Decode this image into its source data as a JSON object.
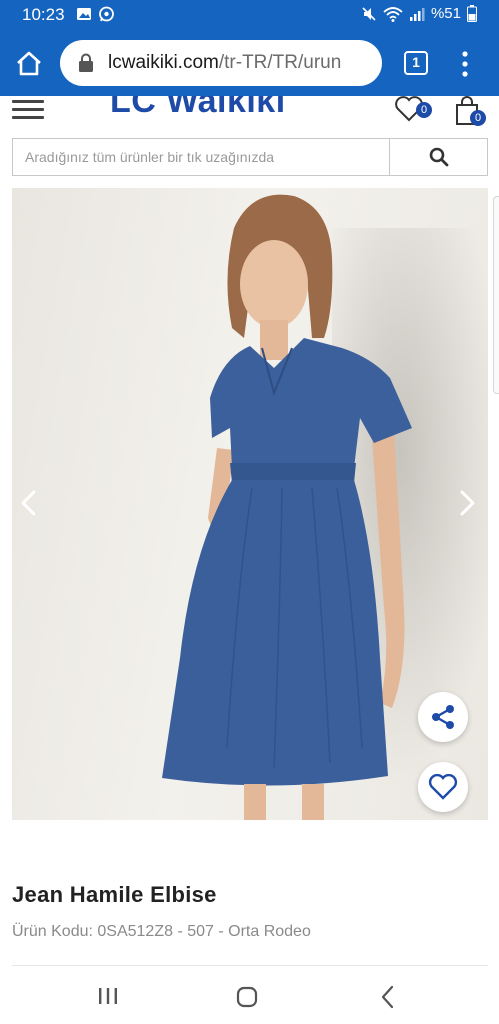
{
  "status_bar": {
    "time": "10:23",
    "battery": "%51"
  },
  "browser": {
    "url_host": "lcwaikiki.com",
    "url_path": "/tr-TR/TR/urun",
    "tab_count": "1"
  },
  "header": {
    "logo": "LC Waikiki",
    "wishlist_count": "0",
    "cart_count": "0"
  },
  "search": {
    "placeholder": "Aradığınız tüm ürünler bir tık uzağınızda"
  },
  "product": {
    "title": "Jean Hamile Elbise",
    "code": "Ürün Kodu: 0SA512Z8 - 507 - Orta Rodeo"
  },
  "colors": {
    "brand_blue": "#1565c0",
    "logo_blue": "#1e4aa8",
    "denim": "#3a5f9a"
  }
}
